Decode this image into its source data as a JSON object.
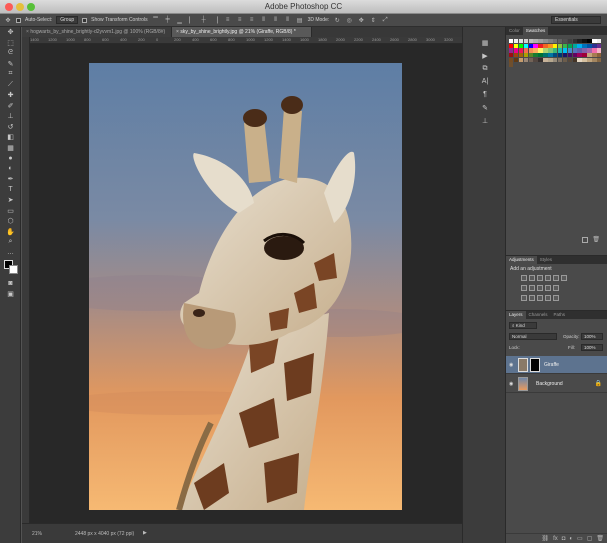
{
  "window": {
    "title": "Adobe Photoshop CC"
  },
  "options_bar": {
    "auto_select_label": "Auto-Select:",
    "auto_select_value": "Group",
    "show_transform_label": "Show Transform Controls",
    "mode_label": "3D Mode:",
    "workspace": "Essentials"
  },
  "doc_tabs": [
    {
      "label": "hogwarts_by_shine_brightly-d2yvvm1.jpg @ 100% (RGB/8#)"
    },
    {
      "label": "sky_by_shine_brightly.jpg @ 21% (Giraffe, RGB/8) *"
    }
  ],
  "ruler_ticks": [
    "1400",
    "1200",
    "1000",
    "800",
    "600",
    "400",
    "200",
    "0",
    "200",
    "400",
    "600",
    "800",
    "1000",
    "1200",
    "1400",
    "1600",
    "1800",
    "2000",
    "2200",
    "2400",
    "2600",
    "2800",
    "3000",
    "3200"
  ],
  "status": {
    "zoom": "21%",
    "doc_size": "2448 px x 4040 px (72 ppi)"
  },
  "color_panel": {
    "tab_color": "Color",
    "tab_swatches": "Swatches"
  },
  "swatch_colors": [
    "#ffffff",
    "#f0f0f0",
    "#e0e0e0",
    "#d0d0d0",
    "#c0c0c0",
    "#b0b0b0",
    "#a0a0a0",
    "#909090",
    "#808080",
    "#707070",
    "#606060",
    "#505050",
    "#404040",
    "#303030",
    "#202020",
    "#101010",
    "#000000",
    "#fff",
    "#eee",
    "#ff0000",
    "#ffff00",
    "#00ff00",
    "#00ffff",
    "#0000ff",
    "#ff00ff",
    "#ee1d24",
    "#f26522",
    "#f7941d",
    "#fff200",
    "#8dc63f",
    "#39b54a",
    "#00a651",
    "#00a99d",
    "#00aeef",
    "#0072bc",
    "#0054a6",
    "#2e3192",
    "#662d91",
    "#92278f",
    "#ec008c",
    "#ed145b",
    "#f26c4f",
    "#f68e56",
    "#fbaf5d",
    "#fff568",
    "#acd372",
    "#7cc576",
    "#3bb878",
    "#1abbb4",
    "#00bff3",
    "#438ccb",
    "#5574b9",
    "#605ca8",
    "#8560a8",
    "#a864a8",
    "#f06eaa",
    "#f3b6c8",
    "#9e0b0f",
    "#a0410d",
    "#a36209",
    "#aba000",
    "#598527",
    "#197b30",
    "#007236",
    "#00746b",
    "#0076a3",
    "#004a80",
    "#003471",
    "#1b1464",
    "#440e62",
    "#630460",
    "#9e005d",
    "#9e0039",
    "#c4a47c",
    "#a67c52",
    "#8c6239",
    "#754c24",
    "#603913",
    "#c69c6d",
    "#998675",
    "#736357",
    "#534741",
    "#362f2d",
    "#c7b299",
    "#b6a88f",
    "#958a7a",
    "#7f7263",
    "#6b5c4b",
    "#57483a",
    "#443426",
    "#e6d7c3",
    "#d5c0a0",
    "#bfa47e",
    "#a38660",
    "#866743",
    "#6e4f2e"
  ],
  "adjustments_panel": {
    "tab_adjustments": "Adjustments",
    "tab_styles": "Styles",
    "heading": "Add an adjustment"
  },
  "layers_panel": {
    "tab_layers": "Layers",
    "tab_channels": "Channels",
    "tab_paths": "Paths",
    "kind": "Kind",
    "blend_mode": "Normal",
    "opacity_label": "Opacity:",
    "opacity_value": "100%",
    "lock_label": "Lock:",
    "fill_label": "Fill:",
    "fill_value": "100%",
    "layers": [
      {
        "name": "Giraffe"
      },
      {
        "name": "Background"
      }
    ]
  }
}
